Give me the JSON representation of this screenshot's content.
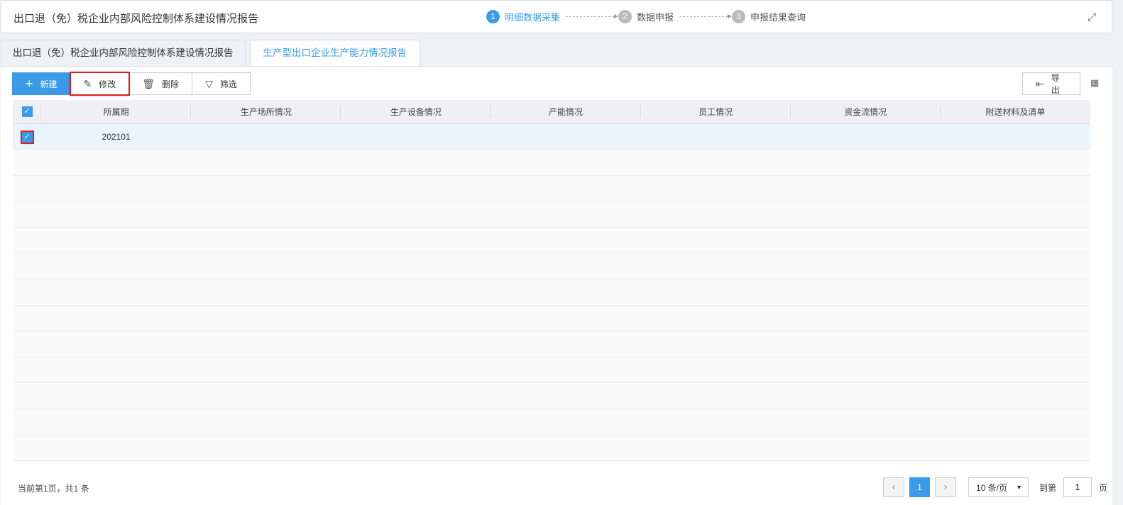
{
  "header": {
    "title": "出口退（免）税企业内部风险控制体系建设情况报告",
    "steps": [
      {
        "num": "1",
        "label": "明细数据采集"
      },
      {
        "num": "2",
        "label": "数据申报"
      },
      {
        "num": "3",
        "label": "申报结果查询"
      }
    ],
    "fullscreen_icon": "⛶"
  },
  "tabs": [
    {
      "label": "出口退（免）税企业内部风险控制体系建设情况报告"
    },
    {
      "label": "生产型出口企业生产能力情况报告"
    }
  ],
  "toolbar": {
    "new": "新建",
    "edit": "修改",
    "delete": "删除",
    "filter": "筛选",
    "export": "导出"
  },
  "table": {
    "columns": [
      "所属期",
      "生产场所情况",
      "生产设备情况",
      "产能情况",
      "员工情况",
      "资金流情况",
      "附送材料及清单"
    ],
    "rows": [
      {
        "period": "202101"
      }
    ]
  },
  "footer": {
    "info": "当前第1页，共1 条",
    "page": "1",
    "page_size": "10 条/页",
    "goto_label": "到第",
    "goto_value": "1",
    "page_suffix": "页"
  },
  "colors": {
    "accent": "#3b9be8",
    "highlight": "#e02020"
  }
}
